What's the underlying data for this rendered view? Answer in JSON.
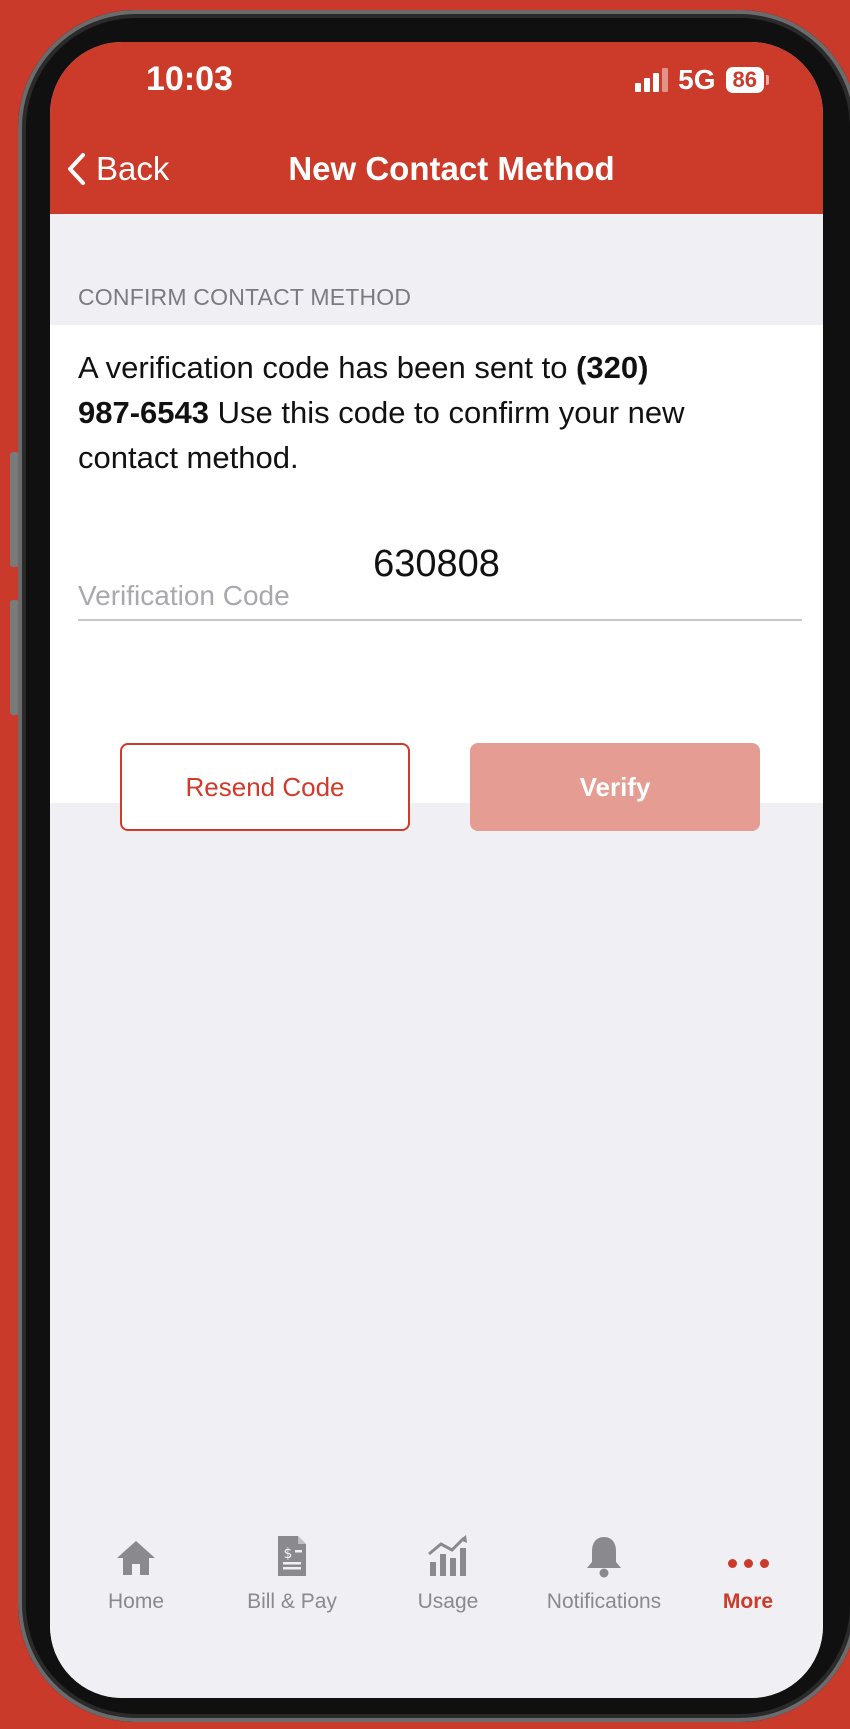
{
  "status_bar": {
    "time": "10:03",
    "network": "5G",
    "battery": "86"
  },
  "nav": {
    "back_label": "Back",
    "title": "New Contact Method"
  },
  "section": {
    "label": "CONFIRM CONTACT METHOD"
  },
  "message": {
    "prefix": "A verification code has been sent to ",
    "phone": "(320) 987-6543",
    "suffix": "  Use this code to confirm your new contact method."
  },
  "verification": {
    "value": "630808",
    "label": "Verification Code"
  },
  "buttons": {
    "resend": "Resend Code",
    "verify": "Verify"
  },
  "tabs": [
    {
      "label": "Home",
      "icon": "home-icon"
    },
    {
      "label": "Bill & Pay",
      "icon": "bill-icon"
    },
    {
      "label": "Usage",
      "icon": "usage-chart-icon"
    },
    {
      "label": "Notifications",
      "icon": "bell-icon"
    },
    {
      "label": "More",
      "icon": "more-dots-icon",
      "active": true
    }
  ],
  "colors": {
    "brand": "#cc3a2a",
    "verify_disabled": "#e59c93",
    "background": "#f0f0f4"
  }
}
